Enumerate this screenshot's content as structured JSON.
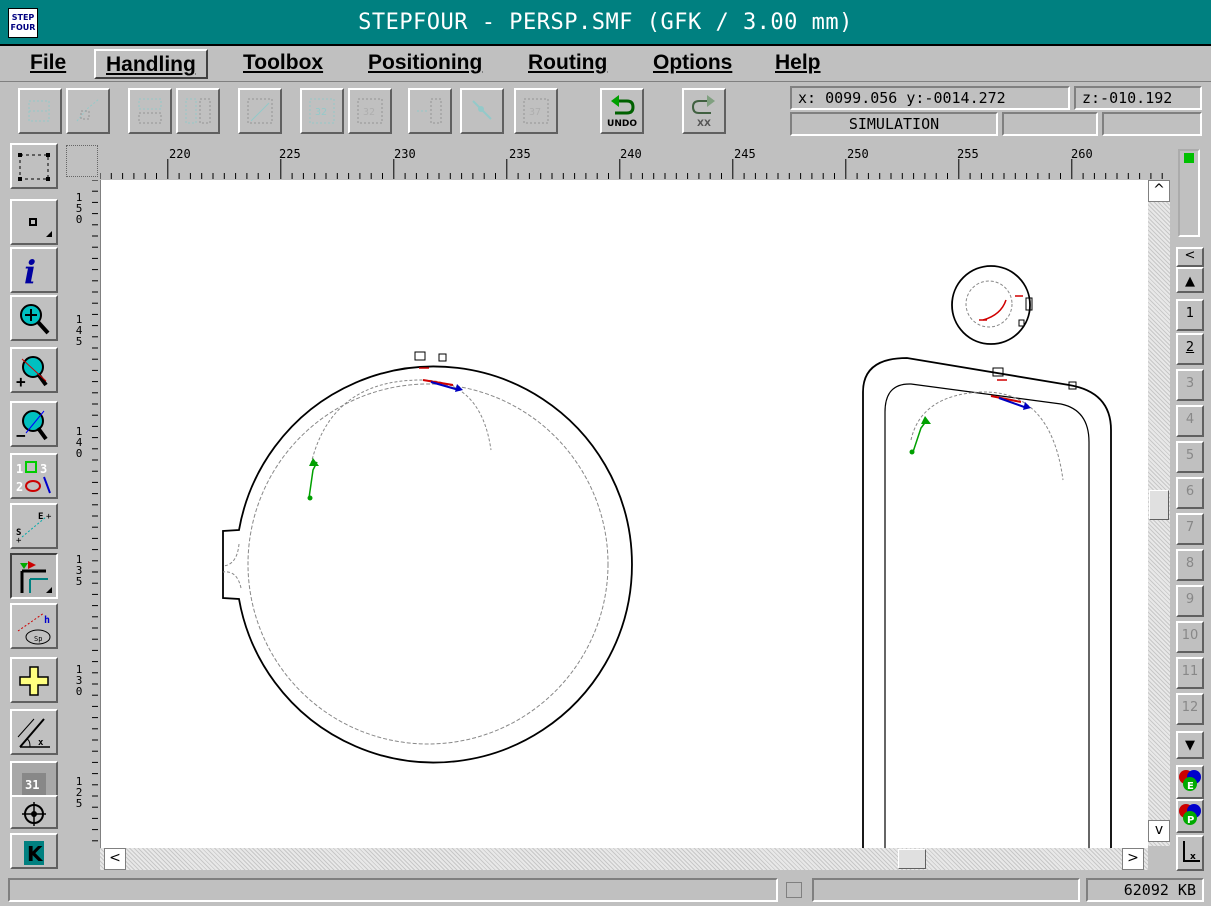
{
  "window": {
    "title": "STEPFOUR - PERSP.SMF (GFK / 3.00 mm)",
    "icon_text_line1": "STEP",
    "icon_text_line2": "FOUR"
  },
  "menu": [
    {
      "label": "File"
    },
    {
      "label": "Handling",
      "active": true
    },
    {
      "label": "Toolbox"
    },
    {
      "label": "Positioning"
    },
    {
      "label": "Routing"
    },
    {
      "label": "Options"
    },
    {
      "label": "Help"
    }
  ],
  "toolbar": {
    "undo_label": "UNDO",
    "redo_label": "XX",
    "coord_readout": "x: 0099.056 y:-0014.272",
    "z_readout": "z:-010.192",
    "mode": "SIMULATION"
  },
  "ruler": {
    "h_ticks": [
      "220",
      "225",
      "230",
      "235",
      "240",
      "245",
      "250",
      "255",
      "260"
    ],
    "v_ticks": [
      "150",
      "145",
      "140",
      "135",
      "130",
      "125"
    ]
  },
  "left_tools": [
    {
      "icon": "select-rect-icon"
    },
    {
      "icon": "point-icon"
    },
    {
      "icon": "info-icon"
    },
    {
      "icon": "zoom-icon"
    },
    {
      "icon": "zoom-in-icon"
    },
    {
      "icon": "zoom-out-icon"
    },
    {
      "icon": "objects-numbering-icon"
    },
    {
      "icon": "start-end-icon"
    },
    {
      "icon": "routing-corner-icon",
      "pressed": true
    },
    {
      "icon": "ramp-icon"
    },
    {
      "icon": "crosshair-plus-icon"
    },
    {
      "icon": "measure-icon"
    },
    {
      "icon": "ocr-icon"
    },
    {
      "icon": "target-icon"
    },
    {
      "icon": "k-icon"
    }
  ],
  "right_panel": {
    "layers": [
      "1",
      "2",
      "3",
      "4",
      "5",
      "6",
      "7",
      "8",
      "9",
      "10",
      "11",
      "12"
    ],
    "active_layers": [
      "1",
      "2"
    ]
  },
  "status": {
    "memory": "62092 KB"
  },
  "colors": {
    "titlebar": "#008080",
    "canvas": "#ffffff",
    "path_green": "#00a000",
    "path_red": "#d00000",
    "path_blue": "#0000c0"
  }
}
